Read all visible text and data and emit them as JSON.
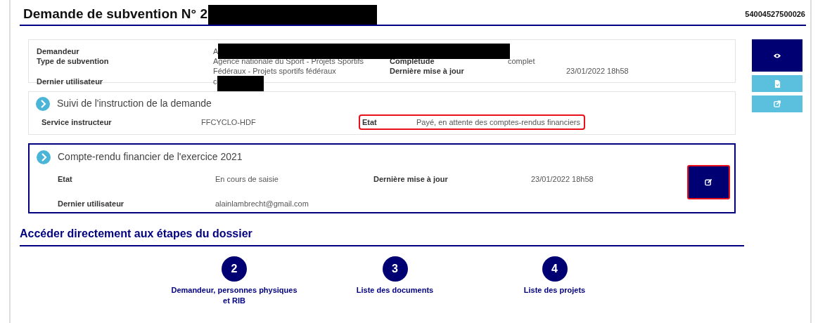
{
  "header": {
    "title": "Demande de subvention N° 2",
    "redacted": true,
    "reference": "54004527500026"
  },
  "summary": {
    "rows": [
      {
        "label": "Demandeur",
        "value": "A",
        "redacted": true
      },
      {
        "label": "Type de subvention",
        "value": "Agence nationale du Sport - Projets Sportifs Fédéraux - Projets sportifs fédéraux",
        "label2": "Complétude",
        "value2": "complet"
      },
      {
        "label": "",
        "value": "",
        "label2": "Dernière mise à jour",
        "value2": "23/01/2022 18h58"
      },
      {
        "label": "Dernier utilisateur",
        "value": "c",
        "redacted": true
      }
    ]
  },
  "side_buttons": [
    {
      "kind": "view",
      "primary": true
    },
    {
      "kind": "document",
      "primary": false
    },
    {
      "kind": "export",
      "primary": false
    }
  ],
  "instruction": {
    "title": "Suivi de l'instruction de la demande",
    "label": "Service instructeur",
    "value": "FFCYCLO-HDF",
    "state_label": "Etat",
    "state_value": "Payé, en attente des comptes-rendus financiers",
    "highlighted": true
  },
  "report": {
    "title": "Compte-rendu financier de l'exercice 2021",
    "selected": true,
    "rows": [
      {
        "label": "Etat",
        "value": "En cours de saisie",
        "label2": "Dernière mise à jour",
        "value2": "23/01/2022 18h58"
      },
      {
        "label": "Dernier utilisateur",
        "value": "alainlambrecht@gmail.com"
      }
    ],
    "edit_highlighted": true
  },
  "steps": {
    "title": "Accéder directement aux étapes du dossier",
    "items": [
      {
        "number": "2",
        "label": "Demandeur, personnes physiques et RIB"
      },
      {
        "number": "3",
        "label": "Liste des documents"
      },
      {
        "number": "4",
        "label": "Liste des projets"
      }
    ]
  }
}
